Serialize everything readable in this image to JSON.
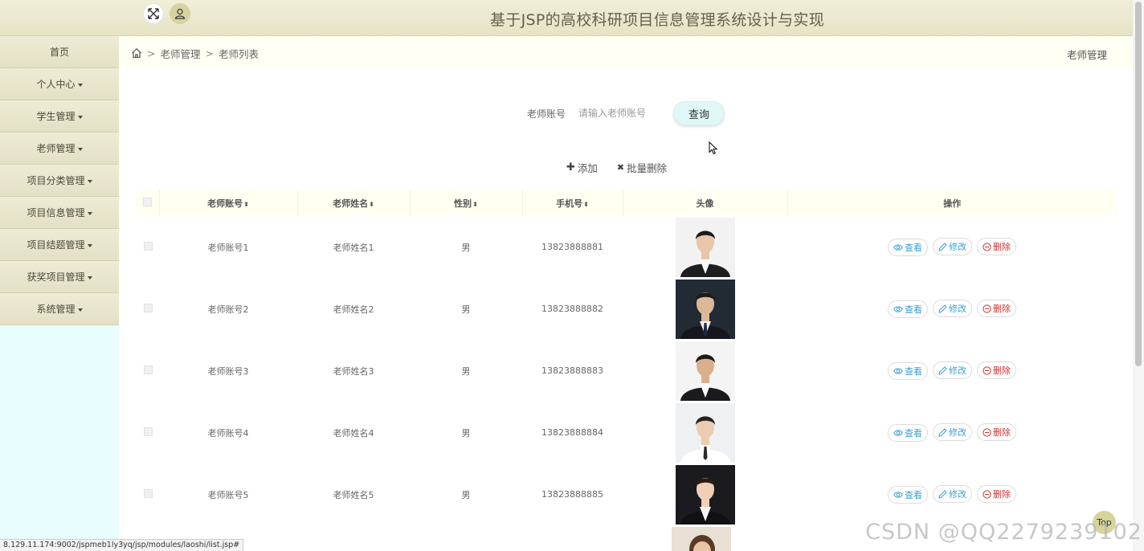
{
  "header": {
    "site_title": "基于JSP的高校科研项目信息管理系统设计与实现"
  },
  "sidebar": {
    "items": [
      {
        "label": "首页",
        "has_caret": false
      },
      {
        "label": "个人中心",
        "has_caret": true
      },
      {
        "label": "学生管理",
        "has_caret": true
      },
      {
        "label": "老师管理",
        "has_caret": true
      },
      {
        "label": "项目分类管理",
        "has_caret": true
      },
      {
        "label": "项目信息管理",
        "has_caret": true
      },
      {
        "label": "项目结题管理",
        "has_caret": true
      },
      {
        "label": "获奖项目管理",
        "has_caret": true
      },
      {
        "label": "系统管理",
        "has_caret": true
      }
    ]
  },
  "breadcrumb": {
    "sep": ">",
    "level1": "老师管理",
    "level2": "老师列表",
    "right_title": "老师管理"
  },
  "search": {
    "label": "老师账号",
    "placeholder": "请输入老师账号",
    "button": "查询"
  },
  "actions": {
    "add_symbol": "✚",
    "add": "添加",
    "batch_delete_symbol": "✖",
    "batch_delete": "批量删除"
  },
  "table": {
    "headers": {
      "account": "老师账号",
      "name": "老师姓名",
      "gender": "性别",
      "phone": "手机号",
      "avatar": "头像",
      "ops": "操作"
    },
    "sort_glyph": "⬍",
    "rows": [
      {
        "account": "老师账号1",
        "name": "老师姓名1",
        "gender": "男",
        "phone": "13823888881"
      },
      {
        "account": "老师账号2",
        "name": "老师姓名2",
        "gender": "男",
        "phone": "13823888882"
      },
      {
        "account": "老师账号3",
        "name": "老师姓名3",
        "gender": "男",
        "phone": "13823888883"
      },
      {
        "account": "老师账号4",
        "name": "老师姓名4",
        "gender": "男",
        "phone": "13823888884"
      },
      {
        "account": "老师账号5",
        "name": "老师姓名5",
        "gender": "男",
        "phone": "13823888885"
      }
    ],
    "ops": {
      "view": "查看",
      "edit": "修改",
      "delete": "删除"
    }
  },
  "status_bar": {
    "url": "8.129.11.174:9002/jspmeb1ly3yq/jsp/modules/laoshi/list.jsp#"
  },
  "top_button": {
    "label": "Top"
  },
  "watermark": {
    "text": "CSDN @QQ2279239102"
  }
}
